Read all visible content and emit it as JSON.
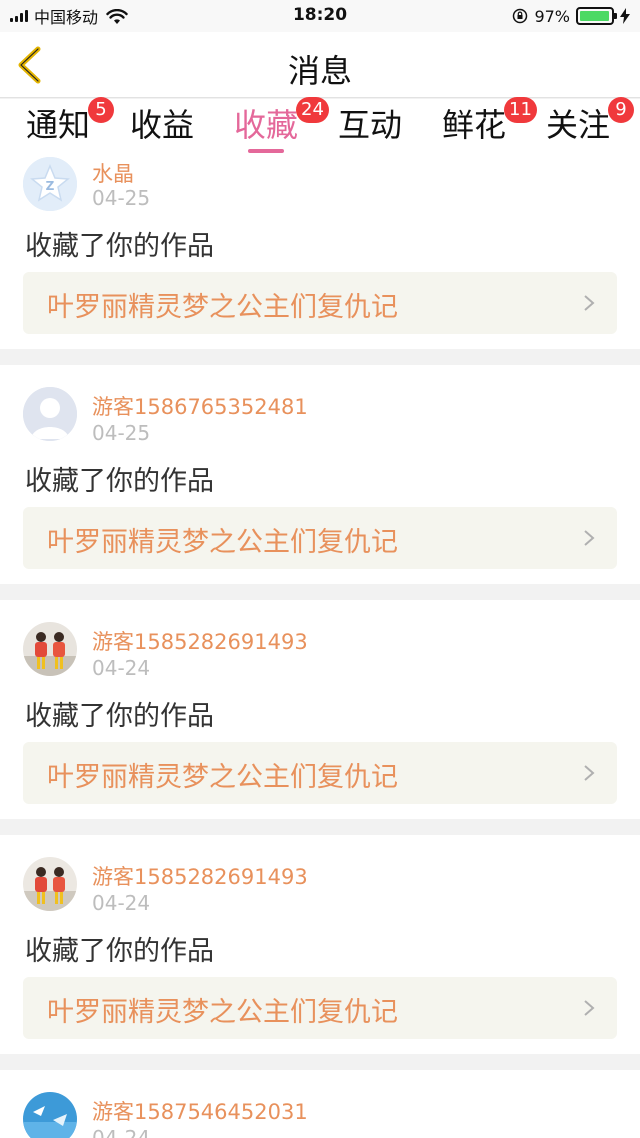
{
  "status_bar": {
    "carrier": "中国移动",
    "time": "18:20",
    "battery_percent": "97%",
    "battery_level": 0.97
  },
  "header": {
    "title": "消息"
  },
  "tabs": [
    {
      "label": "通知",
      "badge": "5",
      "active": false
    },
    {
      "label": "收益",
      "badge": "",
      "active": false
    },
    {
      "label": "收藏",
      "badge": "24",
      "active": true
    },
    {
      "label": "互动",
      "badge": "",
      "active": false
    },
    {
      "label": "鲜花",
      "badge": "11",
      "active": false
    },
    {
      "label": "关注",
      "badge": "9",
      "active": false
    }
  ],
  "messages": [
    {
      "username": "水晶",
      "date": "04-25",
      "action": "收藏了你的作品",
      "work_title": "叶罗丽精灵梦之公主们复仇记",
      "avatar": "qq-default-avatar"
    },
    {
      "username": "游客1586765352481",
      "date": "04-25",
      "action": "收藏了你的作品",
      "work_title": "叶罗丽精灵梦之公主们复仇记",
      "avatar": "guest-default-avatar"
    },
    {
      "username": "游客1585282691493",
      "date": "04-24",
      "action": "收藏了你的作品",
      "work_title": "叶罗丽精灵梦之公主们复仇记",
      "avatar": "photo-avatar"
    },
    {
      "username": "游客1585282691493",
      "date": "04-24",
      "action": "收藏了你的作品",
      "work_title": "叶罗丽精灵梦之公主们复仇记",
      "avatar": "photo-avatar"
    },
    {
      "username": "游客1587546452031",
      "date": "04-24",
      "action": "",
      "work_title": "",
      "avatar": "sky-photo-avatar"
    }
  ],
  "colors": {
    "accent_pink": "#e4689a",
    "username_orange": "#e8915c",
    "badge_red": "#f0393c",
    "battery_green": "#4cd964"
  }
}
